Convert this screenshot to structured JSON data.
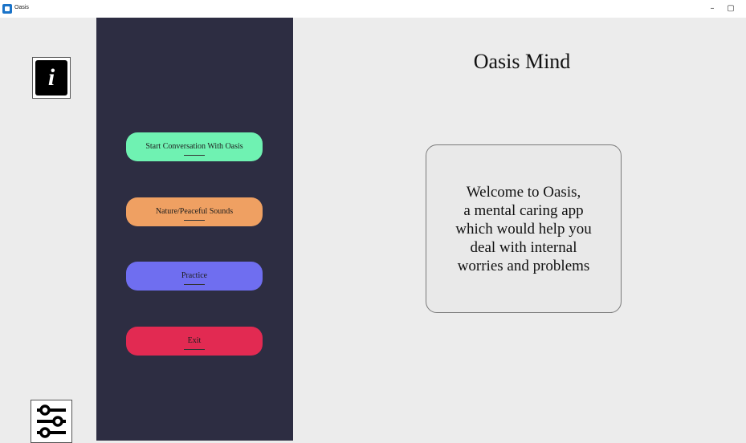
{
  "window": {
    "title": "Oasis",
    "minimize_glyph": "–",
    "restore_glyph": "▢"
  },
  "left_rail": {
    "info_glyph": "i",
    "info_icon": "info-icon",
    "settings_icon": "sliders-icon"
  },
  "menu": {
    "start_label": "Start Conversation With Oasis",
    "nature_label": "Nature/Peaceful Sounds",
    "practice_label": "Practice",
    "exit_label": "Exit",
    "colors": {
      "panel": "#2d2d42",
      "start": "#6ff2b2",
      "nature": "#efa062",
      "practice": "#6f6ef0",
      "exit": "#e22a52"
    }
  },
  "main": {
    "title": "Oasis Mind",
    "welcome_lines": [
      "Welcome to Oasis,",
      "a mental caring app",
      "which would help you",
      "deal with internal",
      "worries and problems"
    ]
  }
}
